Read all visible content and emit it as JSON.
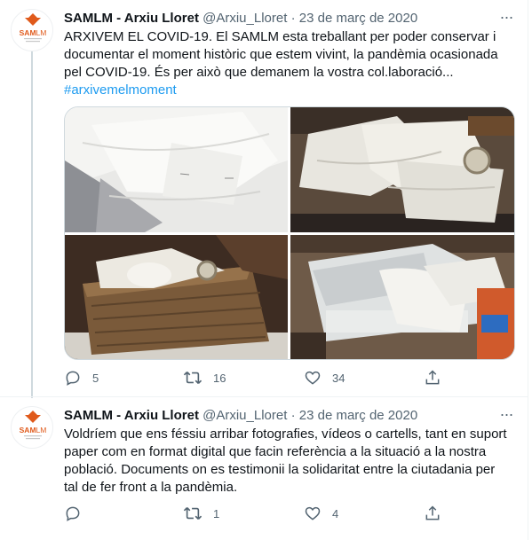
{
  "tweets": [
    {
      "author_name": "SAMLM - Arxiu Lloret",
      "handle": "@Arxiu_Lloret",
      "separator": "·",
      "date": "23 de març de 2020",
      "more": "···",
      "text_lines": [
        "ARXIVEM EL COVID-19. El SAMLM esta treballant per poder conservar i",
        "documentar el moment històric que estem vivint, la pandèmia ocasionada",
        "pel COVID-19. És per això que demanem la vostra col.laboració..."
      ],
      "hashtag": "#arxivemelmoment",
      "replies": "5",
      "retweets": "16",
      "likes": "34"
    },
    {
      "author_name": "SAMLM - Arxiu Lloret",
      "handle": "@Arxiu_Lloret",
      "separator": "·",
      "date": "23 de març de 2020",
      "more": "···",
      "text_lines": [
        "Voldríem que ens féssiu arribar fotografies, vídeos o cartells, tant en suport",
        "paper com en format digital que facin referència a la situació a la nostra",
        "població. Documents on es testimonii la solidaritat entre la ciutadania per",
        "tal de fer front a la pandèmia."
      ],
      "replies": "",
      "retweets": "1",
      "likes": "4"
    }
  ],
  "avatar_logo": {
    "line1": "SAM",
    "line2": "LM",
    "brand_color": "#e05a1b"
  },
  "colors": {
    "accent": "#1d9bf0",
    "secondary_text": "#536471",
    "border": "#cfd9de"
  },
  "icons": [
    "reply-icon",
    "retweet-icon",
    "like-icon",
    "share-icon",
    "more-icon"
  ]
}
